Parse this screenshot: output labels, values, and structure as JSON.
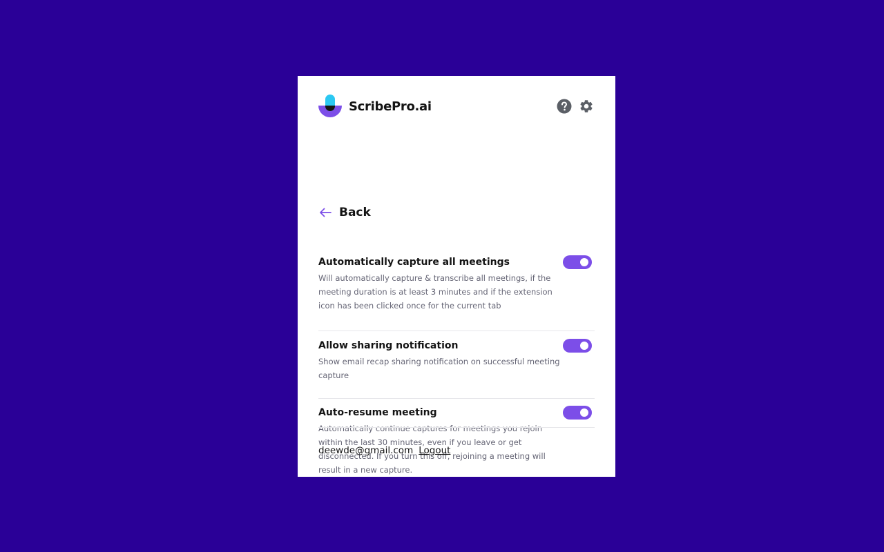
{
  "brand": {
    "name": "ScribePro.ai",
    "accent_color": "#7c4ee8",
    "logo_icon": "microphone-logo-icon"
  },
  "header": {
    "help_icon": "help-icon",
    "settings_icon": "gear-icon"
  },
  "navigation": {
    "back_label": "Back",
    "back_icon": "arrow-left-icon"
  },
  "settings": [
    {
      "title": "Automatically capture all meetings",
      "description": "Will automatically capture & transcribe all meetings, if the meeting duration is at least 3 minutes and if the extension icon has been clicked once for the current tab",
      "enabled": true
    },
    {
      "title": "Allow sharing notification",
      "description": "Show email recap sharing notification on successful meeting capture",
      "enabled": true
    },
    {
      "title": "Auto-resume meeting",
      "description": "Automatically continue captures for meetings you rejoin within the last 30 minutes, even if you leave or get disconnected. If you turn this off, rejoining a meeting will result in a new capture.",
      "enabled": true
    }
  ],
  "footer": {
    "email": "deewde@gmail.com",
    "logout_label": "Logout"
  },
  "colors": {
    "background": "#2a0097",
    "panel": "#ffffff",
    "toggle_on": "#7c4ee8",
    "icon_gray": "#5b5f66"
  }
}
